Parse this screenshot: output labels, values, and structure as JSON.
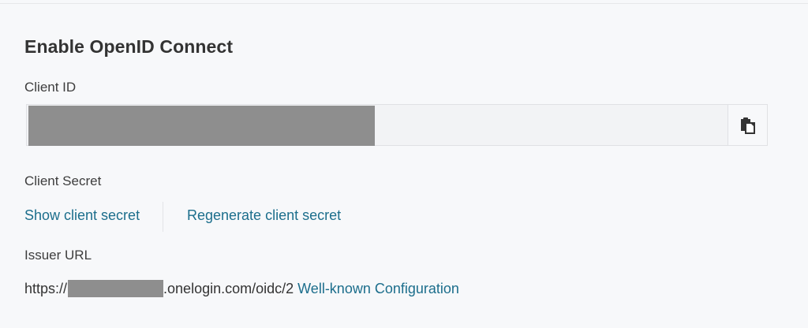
{
  "section": {
    "title": "Enable OpenID Connect"
  },
  "client_id": {
    "label": "Client ID",
    "value": "",
    "copy_icon": "copy-icon"
  },
  "client_secret": {
    "label": "Client Secret",
    "show_link": "Show client secret",
    "regenerate_link": "Regenerate client secret"
  },
  "issuer": {
    "label": "Issuer URL",
    "url_prefix": "https://",
    "url_suffix": ".onelogin.com/oidc/2",
    "well_known_link": "Well-known Configuration"
  },
  "colors": {
    "link": "#1c6e8c",
    "redaction": "#8e8e8e",
    "background": "#f7f8fa"
  }
}
